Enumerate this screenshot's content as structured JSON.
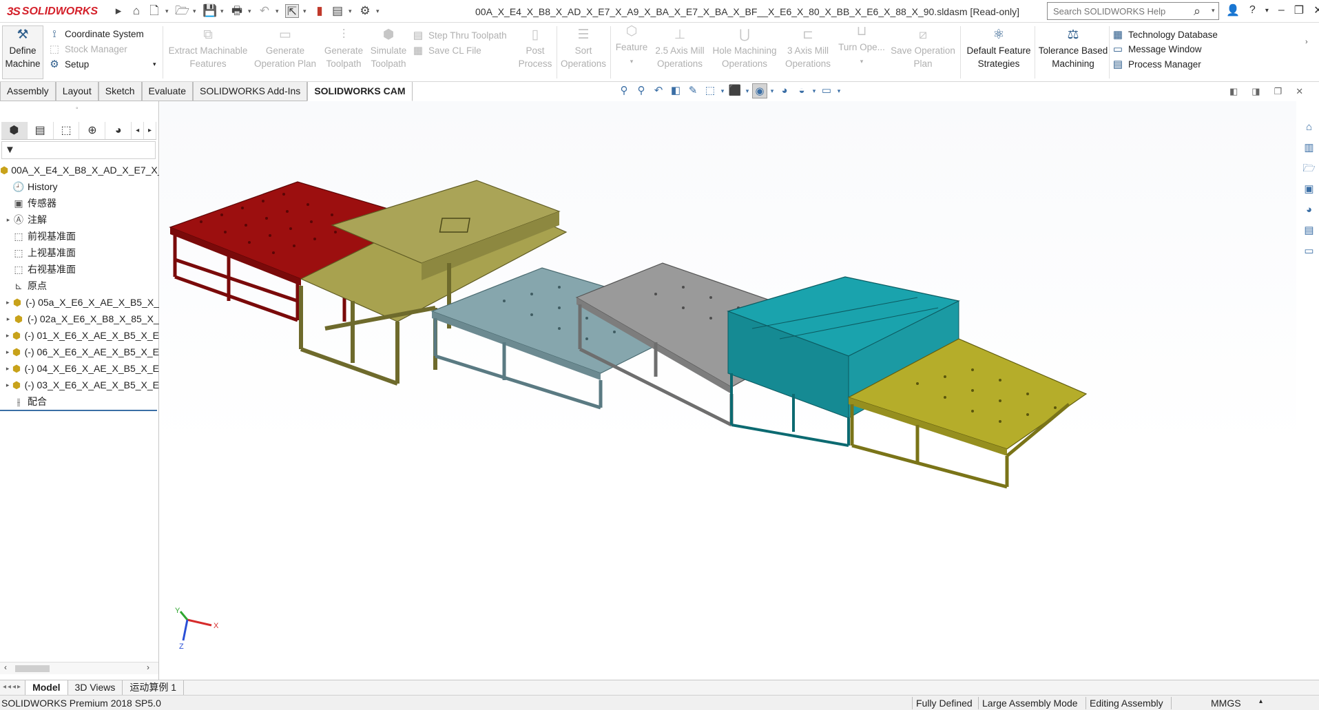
{
  "title_bar": {
    "logo_ds": "3S",
    "logo_text": "SOLIDWORKS",
    "document_title": "00A_X_E4_X_B8_X_AD_X_E7_X_A9_X_BA_X_E7_X_BA_X_BF__X_E6_X_80_X_BB_X_E6_X_88_X_90.sldasm [Read-only]",
    "search_placeholder": "Search SOLIDWORKS Help"
  },
  "ribbon": {
    "define_machine": [
      "Define",
      "Machine"
    ],
    "coordinate_system": "Coordinate System",
    "stock_manager": "Stock Manager",
    "setup": "Setup",
    "extract_features": [
      "Extract Machinable",
      "Features"
    ],
    "generate_operation_plan": [
      "Generate",
      "Operation Plan"
    ],
    "generate_toolpath": [
      "Generate",
      "Toolpath"
    ],
    "simulate_toolpath": [
      "Simulate",
      "Toolpath"
    ],
    "step_thru_toolpath": "Step Thru Toolpath",
    "save_cl_file": "Save CL File",
    "post_process": [
      "Post",
      "Process"
    ],
    "sort_operations": [
      "Sort",
      "Operations"
    ],
    "feature": "Feature",
    "axis_mill_operations": [
      "2.5 Axis Mill",
      "Operations"
    ],
    "hole_machining_operations": [
      "Hole Machining",
      "Operations"
    ],
    "three_axis_mill_operations": [
      "3 Axis Mill",
      "Operations"
    ],
    "turn_operations": "Turn Ope...",
    "save_operation_plan": [
      "Save Operation",
      "Plan"
    ],
    "default_feature_strategies": [
      "Default Feature",
      "Strategies"
    ],
    "tolerance_based_machining": [
      "Tolerance Based",
      "Machining"
    ],
    "technology_database": "Technology Database",
    "message_window": "Message Window",
    "process_manager": "Process Manager"
  },
  "command_tabs": [
    "Assembly",
    "Layout",
    "Sketch",
    "Evaluate",
    "SOLIDWORKS Add-Ins",
    "SOLIDWORKS CAM"
  ],
  "feature_tree": {
    "filter_symbol": "▼",
    "items": [
      {
        "label": "00A_X_E4_X_B8_X_AD_X_E7_X_",
        "icon": "assembly-icon",
        "arrow": ""
      },
      {
        "label": "History",
        "icon": "history-icon",
        "arrow": ""
      },
      {
        "label": "传感器",
        "icon": "sensor-icon",
        "arrow": ""
      },
      {
        "label": "注解",
        "icon": "annotation-icon",
        "arrow": "▸"
      },
      {
        "label": "前视基准面",
        "icon": "plane-icon",
        "arrow": ""
      },
      {
        "label": "上视基准面",
        "icon": "plane-icon",
        "arrow": ""
      },
      {
        "label": "右视基准面",
        "icon": "plane-icon",
        "arrow": ""
      },
      {
        "label": "原点",
        "icon": "origin-icon",
        "arrow": ""
      },
      {
        "label": "(-) 05a_X_E6_X_AE_X_B5_X_",
        "icon": "subassembly-icon",
        "arrow": "▸"
      },
      {
        "label": "(-) 02a_X_E6_X_B8_X_85_X_",
        "icon": "subassembly-icon",
        "arrow": "▸"
      },
      {
        "label": "(-) 01_X_E6_X_AE_X_B5_X_E",
        "icon": "subassembly-icon",
        "arrow": "▸"
      },
      {
        "label": "(-) 06_X_E6_X_AE_X_B5_X_E",
        "icon": "subassembly-icon",
        "arrow": "▸"
      },
      {
        "label": "(-) 04_X_E6_X_AE_X_B5_X_E",
        "icon": "subassembly-icon",
        "arrow": "▸"
      },
      {
        "label": "(-) 03_X_E6_X_AE_X_B5_X_E",
        "icon": "subassembly-icon",
        "arrow": "▸"
      },
      {
        "label": "配合",
        "icon": "mates-icon",
        "arrow": ""
      }
    ]
  },
  "triad": {
    "x": "X",
    "y": "Y",
    "z": "Z"
  },
  "bottom_tabs": [
    "Model",
    "3D Views",
    "运动算例 1"
  ],
  "status_bar": {
    "product": "SOLIDWORKS Premium 2018 SP5.0",
    "definition": "Fully Defined",
    "mode": "Large Assembly Mode",
    "editing": "Editing Assembly",
    "units": "MMGS"
  },
  "colors": {
    "red_module": "#9c0f0f",
    "olive_module": "#a8a24f",
    "steel_blue_module": "#86a6ad",
    "gray_module": "#9a9a9a",
    "teal_module": "#1aa3ad",
    "yellow_module": "#b5ad2a"
  }
}
